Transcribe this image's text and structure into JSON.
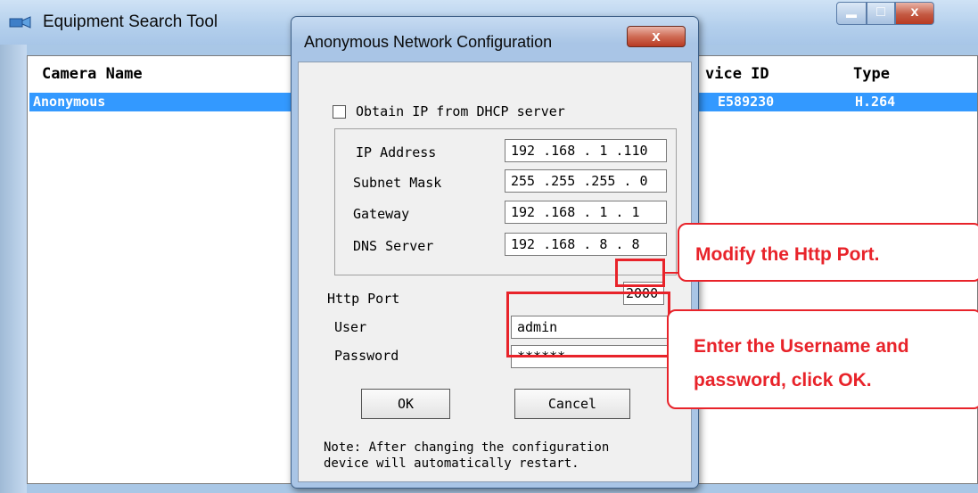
{
  "main_window": {
    "title": "Equipment Search Tool",
    "minimize_glyph": "▬",
    "maximize_glyph": "□",
    "close_glyph": "x",
    "columns": [
      "Camera Name",
      "vice ID",
      "Type"
    ],
    "rows": [
      {
        "camera_name": "Anonymous",
        "device_id": "E589230",
        "type": "H.264"
      }
    ]
  },
  "dialog": {
    "title": "Anonymous Network Configuration",
    "close_glyph": "x",
    "dhcp_label": "Obtain IP from DHCP server",
    "fields": {
      "ip_label": "IP Address",
      "ip_value": "192 .168 . 1  .110",
      "subnet_label": "Subnet Mask",
      "subnet_value": "255 .255 .255 . 0",
      "gateway_label": "Gateway",
      "gateway_value": "192 .168 . 1  . 1",
      "dns_label": "DNS Server",
      "dns_value": "192 .168 . 8  . 8",
      "http_port_label": "Http Port",
      "http_port_value": "2000",
      "user_label": "User",
      "user_value": "admin",
      "password_label": "Password",
      "password_value": "******"
    },
    "ok_label": "OK",
    "cancel_label": "Cancel",
    "note_line1": "Note: After changing the configuration",
    "note_line2": "device will automatically restart."
  },
  "annotations": {
    "http_port_callout": "Modify the Http Port.",
    "credentials_callout_line1": "Enter the Username and",
    "credentials_callout_line2": "password, click OK."
  },
  "colors": {
    "accent_selection": "#3399ff",
    "annotation_red": "#e8232a",
    "window_frame": "#a9c7e6"
  }
}
